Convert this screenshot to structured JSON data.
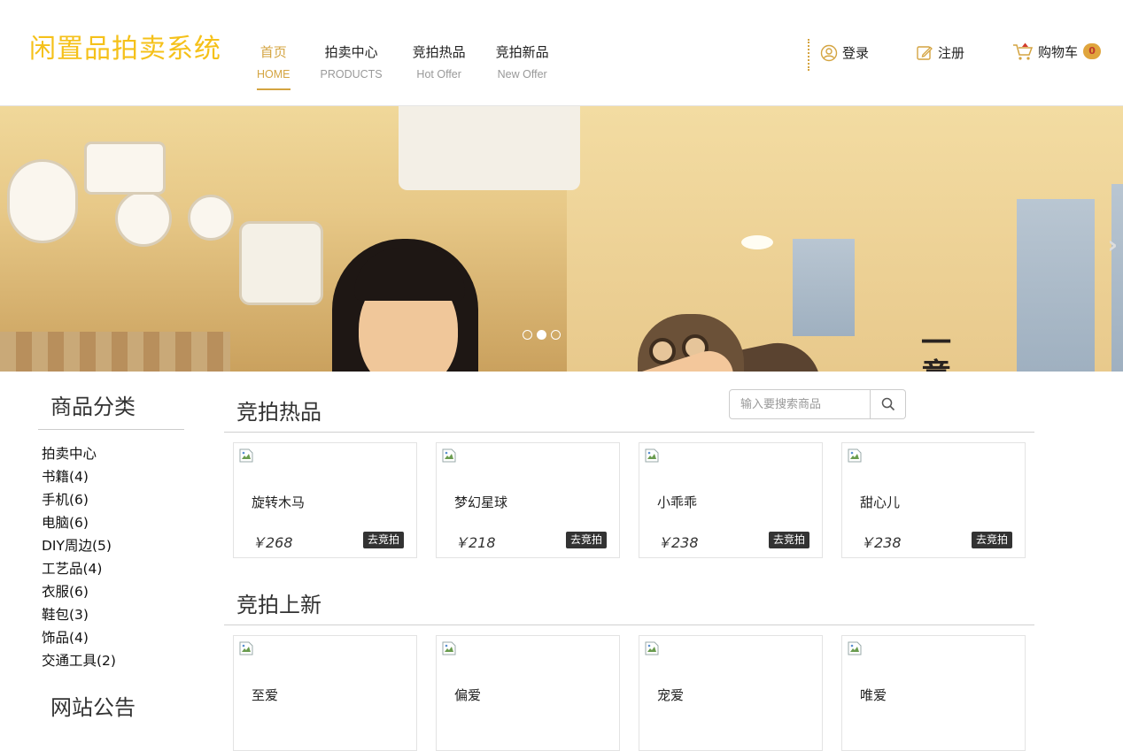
{
  "logo": "闲置品拍卖系统",
  "nav": [
    {
      "cn": "首页",
      "en": "HOME"
    },
    {
      "cn": "拍卖中心",
      "en": "PRODUCTS"
    },
    {
      "cn": "竞拍热品",
      "en": "Hot Offer"
    },
    {
      "cn": "竞拍新品",
      "en": "New Offer"
    }
  ],
  "header": {
    "login": "登录",
    "register": "注册",
    "cart": "购物车",
    "cart_count": "0"
  },
  "banner": {
    "calligraphy": "一意壱壹",
    "next_arrow": "›",
    "active_slide": 2,
    "slide_count": 3
  },
  "sidebar": {
    "title": "商品分类",
    "items": [
      "拍卖中心",
      "书籍(4)",
      "手机(6)",
      "电脑(6)",
      "DIY周边(5)",
      "工艺品(4)",
      "衣服(6)",
      "鞋包(3)",
      "饰品(4)",
      "交通工具(2)"
    ],
    "title2": "网站公告"
  },
  "hot": {
    "title": "竞拍热品",
    "search_placeholder": "输入要搜索商品",
    "items": [
      {
        "name": "旋转木马",
        "price": "￥268",
        "button": "去竞拍"
      },
      {
        "name": "梦幻星球",
        "price": "￥218",
        "button": "去竞拍"
      },
      {
        "name": "小乖乖",
        "price": "￥238",
        "button": "去竞拍"
      },
      {
        "name": "甜心儿",
        "price": "￥238",
        "button": "去竞拍"
      }
    ]
  },
  "new": {
    "title": "竞拍上新",
    "items": [
      {
        "name": "至爱"
      },
      {
        "name": "偏爱"
      },
      {
        "name": "宠爱"
      },
      {
        "name": "唯爱"
      }
    ]
  }
}
